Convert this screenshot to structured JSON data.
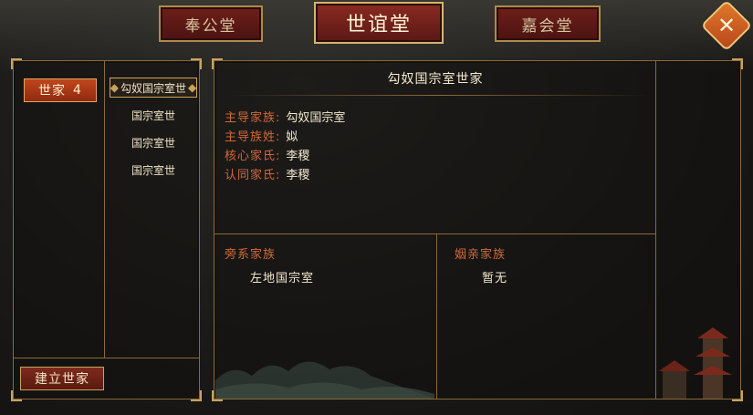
{
  "tabs": [
    {
      "label": "奉公堂"
    },
    {
      "label": "世谊堂"
    },
    {
      "label": "嘉会堂"
    }
  ],
  "close_icon": "close-icon",
  "left_panel": {
    "clan_button": {
      "label": "世家",
      "count": "4"
    },
    "families": [
      {
        "label": "勾奴国宗室世"
      },
      {
        "label": "国宗室世"
      },
      {
        "label": "国宗室世"
      },
      {
        "label": "国宗室世"
      }
    ],
    "found_button": "建立世家"
  },
  "detail": {
    "title": "勾奴国宗室世家",
    "rows": [
      {
        "label": "主导家族:",
        "value": "勾奴国宗室"
      },
      {
        "label": "主导族姓:",
        "value": "姒"
      },
      {
        "label": "核心家氏:",
        "value": "李稷"
      },
      {
        "label": "认同家氏:",
        "value": "李稷"
      }
    ],
    "collateral": {
      "title": "旁系家族",
      "value": "左地国宗室"
    },
    "marriage": {
      "title": "姻亲家族",
      "value": "暂无"
    }
  },
  "colors": {
    "accent": "#d2683a",
    "frame": "#8a6a3a",
    "tab_bg": "#6e1f1a"
  }
}
